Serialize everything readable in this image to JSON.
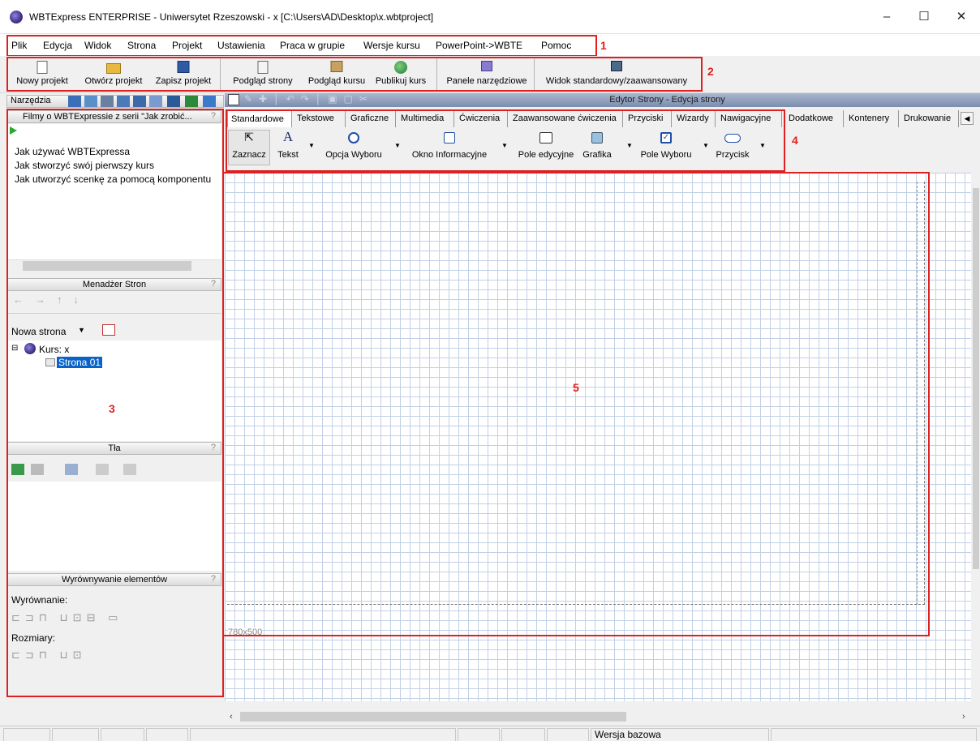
{
  "window": {
    "title": "WBTExpress ENTERPRISE - Uniwersytet Rzeszowski - x [C:\\Users\\AD\\Desktop\\x.wbtproject]",
    "minimize": "–",
    "maximize": "☐",
    "close": "✕"
  },
  "menu": [
    "Plik",
    "Edycja",
    "Widok",
    "Strona",
    "Projekt",
    "Ustawienia",
    "Praca w grupie",
    "Wersje kursu",
    "PowerPoint->WBTE",
    "Pomoc"
  ],
  "annotations": [
    "1",
    "2",
    "3",
    "4",
    "5"
  ],
  "toolbar": {
    "new_project": "Nowy projekt",
    "open_project": "Otwórz projekt",
    "save_project": "Zapisz projekt",
    "page_preview": "Podgląd strony",
    "course_preview": "Podgląd kursu",
    "publish_course": "Publikuj kurs",
    "tool_panels": "Panele narzędziowe",
    "view_mode": "Widok standardowy/zaawansowany"
  },
  "left": {
    "tools_label": "Narzędzia",
    "films_header": "Filmy o WBTExpressie z serii \"Jak zrobić...",
    "films": [
      "Jak używać WBTExpressa",
      "Jak stworzyć swój pierwszy kurs",
      "Jak utworzyć scenkę za pomocą komponentu"
    ],
    "page_manager_header": "Menadżer Stron",
    "new_page": "Nowa strona",
    "tree_course": "Kurs: x",
    "tree_page": "Strona 01",
    "backgrounds_header": "Tła",
    "align_header": "Wyrównywanie elementów",
    "align_label": "Wyrównanie:",
    "sizes_label": "Rozmiary:",
    "help": "?"
  },
  "editor": {
    "title": "Edytor Strony - Edycja strony",
    "tabs": [
      "Standardowe",
      "Tekstowe",
      "Graficzne",
      "Multimedia",
      "Ćwiczenia",
      "Zaawansowane ćwiczenia",
      "Przyciski",
      "Wizardy",
      "Nawigacyjne",
      "Dodatkowe",
      "Kontenery",
      "Drukowanie"
    ],
    "components": [
      "Zaznacz",
      "Tekst",
      "Opcja Wyboru",
      "Okno Informacyjne",
      "Pole edycyjne",
      "Grafika",
      "Pole Wyboru",
      "Przycisk"
    ],
    "canvas_size": "780x500"
  },
  "status": {
    "version": "Wersja bazowa"
  },
  "colors": {
    "annotation": "#e02020",
    "grid": "#c2d0e6",
    "selection": "#0a64c8"
  }
}
